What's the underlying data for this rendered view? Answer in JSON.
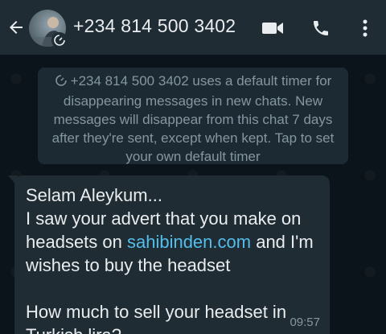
{
  "header": {
    "contact_name": "+234 814 500 3402",
    "back_icon": "arrow-left-icon",
    "video_icon": "video-camera-icon",
    "call_icon": "phone-icon",
    "menu_icon": "more-vertical-icon"
  },
  "system_message": {
    "icon": "timer-icon",
    "text": "+234 814 500 3402 uses a default timer for disappearing messages in new chats. New messages will disappear from this chat 7 days after they're sent, except when kept. Tap to set your own default timer"
  },
  "message": {
    "line1": "Selam Aleykum...",
    "line2_before": "I saw your advert that you make on headsets on ",
    "link": "sahibinden.com",
    "line2_after": " and I'm wishes to buy the headset",
    "line3": "How much to sell your headset in Turkish lira?",
    "time": "09:57"
  },
  "colors": {
    "header_bg": "#1f2c34",
    "chat_bg": "#0b141a",
    "bubble_bg": "#202c33",
    "text_primary": "#e9edef",
    "text_secondary": "#8696a0",
    "link": "#53bdeb"
  }
}
